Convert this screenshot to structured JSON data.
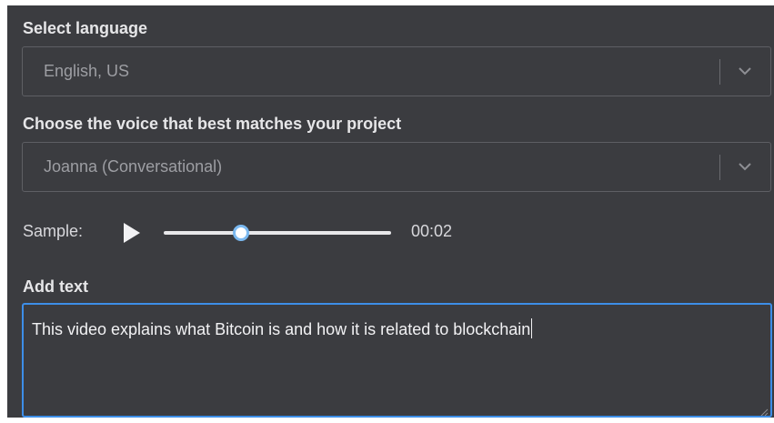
{
  "language": {
    "label": "Select language",
    "selected": "English, US",
    "icon": "chevron-down-icon"
  },
  "voice": {
    "label": "Choose the voice that best matches your project",
    "selected": "Joanna (Conversational)",
    "icon": "chevron-down-icon"
  },
  "sample": {
    "label": "Sample:",
    "play_icon": "play-icon",
    "progress_fraction": 0.34,
    "time": "00:02"
  },
  "text_input": {
    "label": "Add text",
    "value": "This video explains what Bitcoin is and how it is related to blockchain"
  },
  "colors": {
    "panel_background": "#3b3c40",
    "focus_border": "#3d8ee8",
    "slider_thumb_ring": "#7bb9f0"
  }
}
